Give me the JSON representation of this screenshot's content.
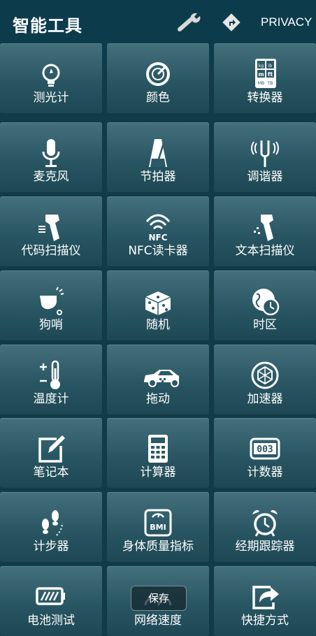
{
  "header": {
    "title": "智能工具",
    "privacy_label": "PRIVACY",
    "icons": [
      "wrench-icon",
      "navigation-icon"
    ]
  },
  "tiles": [
    {
      "label": "测光计",
      "icon": "light-meter-icon"
    },
    {
      "label": "颜色",
      "icon": "color-icon"
    },
    {
      "label": "转换器",
      "icon": "converter-icon"
    },
    {
      "label": "麦克风",
      "icon": "microphone-icon"
    },
    {
      "label": "节拍器",
      "icon": "metronome-icon"
    },
    {
      "label": "调谐器",
      "icon": "tuning-fork-icon"
    },
    {
      "label": "代码扫描仪",
      "icon": "barcode-scanner-icon"
    },
    {
      "label": "NFC读卡器",
      "icon": "nfc-icon"
    },
    {
      "label": "文本扫描仪",
      "icon": "text-scanner-icon"
    },
    {
      "label": "狗哨",
      "icon": "whistle-icon"
    },
    {
      "label": "随机",
      "icon": "dice-icon"
    },
    {
      "label": "时区",
      "icon": "globe-clock-icon"
    },
    {
      "label": "温度计",
      "icon": "thermometer-icon"
    },
    {
      "label": "拖动",
      "icon": "car-icon"
    },
    {
      "label": "加速器",
      "icon": "accelerometer-icon"
    },
    {
      "label": "笔记本",
      "icon": "notebook-icon"
    },
    {
      "label": "计算器",
      "icon": "calculator-icon"
    },
    {
      "label": "计数器",
      "icon": "counter-icon"
    },
    {
      "label": "计步器",
      "icon": "footsteps-icon"
    },
    {
      "label": "身体质量指标",
      "icon": "bmi-scale-icon"
    },
    {
      "label": "经期跟踪器",
      "icon": "alarm-clock-icon"
    },
    {
      "label": "电池测试",
      "icon": "battery-icon"
    },
    {
      "label": "网络速度",
      "icon": "speedometer-icon"
    },
    {
      "label": "快捷方式",
      "icon": "share-icon"
    }
  ],
  "icon_text": {
    "converter_top": "kg",
    "converter_top2": "lb",
    "converter_mid": "m",
    "converter_mid2": "ft",
    "converter_bot": "MB",
    "converter_bot2": "TB",
    "nfc": "NFC",
    "bmi": "BMI",
    "counter": "003"
  },
  "toast": {
    "label": "保存"
  },
  "colors": {
    "topbar": "#0c3c4c",
    "tile": "#2c5966",
    "background": "#113b46"
  }
}
